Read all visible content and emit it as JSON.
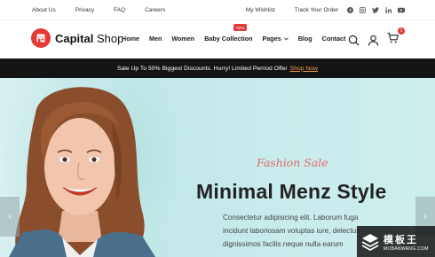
{
  "topbar": {
    "links_left": [
      "About Us",
      "Privacy",
      "FAQ",
      "Careers"
    ],
    "links_right": [
      "My Wishlist",
      "Track Your Order"
    ],
    "social_icons": [
      "facebook-icon",
      "instagram-icon",
      "twitter-icon",
      "linkedin-icon",
      "youtube-icon"
    ]
  },
  "header": {
    "brand_bold": "Capital",
    "brand_light": "Shop",
    "nav": [
      "Home",
      "Men",
      "Women",
      "Baby Collection",
      "Pages",
      "Blog",
      "Contact"
    ],
    "new_badge": "New",
    "cart_count": "1"
  },
  "promo": {
    "text": "Sale Up To 50% Biggest Discounts. Hurry! Limited Perriod Offer",
    "link": "Shop Now"
  },
  "hero": {
    "script_title": "Fashion Sale",
    "headline": "Minimal Menz Style",
    "body_lines": [
      "Consectetur adipisicing elit. Laborum fuga",
      "incidunt laboriosam voluptas iure, delectus",
      "dignissimos facilis neque nulla earum"
    ],
    "prev_arrow": "‹",
    "next_arrow": "›"
  },
  "watermark": {
    "cn": "模板王",
    "url": "MOBANWANG.COM"
  },
  "colors": {
    "accent": "#e53935",
    "promo_link": "#f2a23c",
    "promo_bg": "#141414",
    "hero_bg": "#c8ebeb",
    "script": "#e46a6a"
  }
}
